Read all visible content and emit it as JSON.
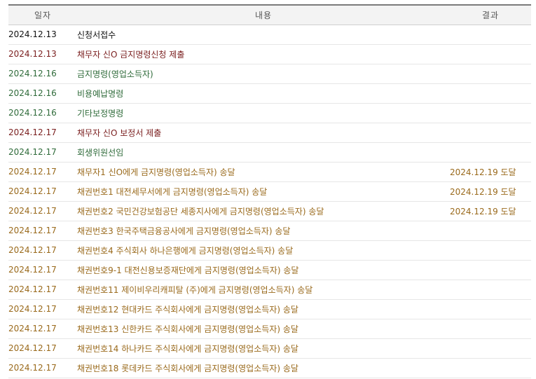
{
  "headers": {
    "date": "일자",
    "content": "내용",
    "result": "결과"
  },
  "colors": {
    "black": "#111111",
    "maroon": "#7a1e1e",
    "green": "#2f6b3a",
    "brown": "#9a6a1c"
  },
  "rows": [
    {
      "date": "2024.12.13",
      "content": "신청서접수",
      "result": "",
      "kind": "black"
    },
    {
      "date": "2024.12.13",
      "content": "채무자 신O 금지명령신청 제출",
      "result": "",
      "kind": "maroon"
    },
    {
      "date": "2024.12.16",
      "content": "금지명령(영업소득자)",
      "result": "",
      "kind": "green"
    },
    {
      "date": "2024.12.16",
      "content": "비용예납명령",
      "result": "",
      "kind": "green"
    },
    {
      "date": "2024.12.16",
      "content": "기타보정명령",
      "result": "",
      "kind": "green"
    },
    {
      "date": "2024.12.17",
      "content": "채무자 신O 보정서 제출",
      "result": "",
      "kind": "maroon"
    },
    {
      "date": "2024.12.17",
      "content": "회생위원선임",
      "result": "",
      "kind": "green"
    },
    {
      "date": "2024.12.17",
      "content": "채무자1 신O에게 금지명령(영업소득자) 송달",
      "result": "2024.12.19 도달",
      "kind": "brown"
    },
    {
      "date": "2024.12.17",
      "content": "채권번호1 대전세무서에게 금지명령(영업소득자) 송달",
      "result": "2024.12.19 도달",
      "kind": "brown"
    },
    {
      "date": "2024.12.17",
      "content": "채권번호2 국민건강보험공단 세종지사에게 금지명령(영업소득자) 송달",
      "result": "2024.12.19 도달",
      "kind": "brown"
    },
    {
      "date": "2024.12.17",
      "content": "채권번호3 한국주택금융공사에게 금지명령(영업소득자) 송달",
      "result": "",
      "kind": "brown"
    },
    {
      "date": "2024.12.17",
      "content": "채권번호4 주식회사 하나은행에게 금지명령(영업소득자) 송달",
      "result": "",
      "kind": "brown"
    },
    {
      "date": "2024.12.17",
      "content": "채권번호9-1 대전신용보증재단에게 금지명령(영업소득자) 송달",
      "result": "",
      "kind": "brown"
    },
    {
      "date": "2024.12.17",
      "content": "채권번호11 제이비우리캐피탈 (주)에게 금지명령(영업소득자) 송달",
      "result": "",
      "kind": "brown"
    },
    {
      "date": "2024.12.17",
      "content": "채권번호12 현대카드 주식회사에게 금지명령(영업소득자) 송달",
      "result": "",
      "kind": "brown"
    },
    {
      "date": "2024.12.17",
      "content": "채권번호13 신한카드 주식회사에게 금지명령(영업소득자) 송달",
      "result": "",
      "kind": "brown"
    },
    {
      "date": "2024.12.17",
      "content": "채권번호14 하나카드 주식회사에게 금지명령(영업소득자) 송달",
      "result": "",
      "kind": "brown"
    },
    {
      "date": "2024.12.17",
      "content": "채권번호18 롯데카드 주식회사에게 금지명령(영업소득자) 송달",
      "result": "",
      "kind": "brown"
    }
  ]
}
